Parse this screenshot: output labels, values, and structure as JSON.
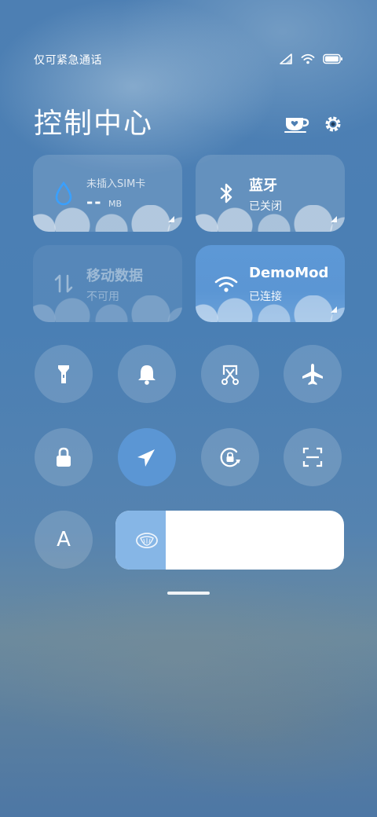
{
  "status_bar": {
    "carrier_text": "仅可紧急通话",
    "icons": [
      "signal-icon",
      "wifi-icon",
      "battery-icon"
    ]
  },
  "header": {
    "title": "控制中心",
    "icons": [
      "coffee-mug-icon",
      "settings-gear-icon"
    ]
  },
  "tiles": {
    "data_usage": {
      "label": "未插入SIM卡",
      "value": "--",
      "unit": "MB",
      "icon": "water-drop-icon"
    },
    "bluetooth": {
      "title": "蓝牙",
      "status": "已关闭",
      "icon": "bluetooth-icon"
    },
    "mobile_data": {
      "title": "移动数据",
      "status": "不可用",
      "icon": "data-arrows-icon"
    },
    "wifi": {
      "title": "DemoMod",
      "status": "已连接",
      "icon": "wifi-icon"
    }
  },
  "toggles": [
    {
      "name": "flashlight",
      "icon": "flashlight-icon",
      "active": false
    },
    {
      "name": "ringer",
      "icon": "bell-icon",
      "active": false
    },
    {
      "name": "screenshot",
      "icon": "scissors-icon",
      "active": false
    },
    {
      "name": "airplane",
      "icon": "airplane-icon",
      "active": false
    },
    {
      "name": "lock-screen",
      "icon": "lock-icon",
      "active": false
    },
    {
      "name": "location",
      "icon": "location-arrow-icon",
      "active": true
    },
    {
      "name": "rotation-lock",
      "icon": "rotation-lock-icon",
      "active": false
    },
    {
      "name": "scanner",
      "icon": "scan-icon",
      "active": false
    }
  ],
  "auto_brightness": {
    "icon_text": "A"
  },
  "brightness": {
    "level": 0.22,
    "icon": "brightness-icon"
  },
  "colors": {
    "active": "#5b96d4",
    "slider_fill": "#86b6e6"
  }
}
